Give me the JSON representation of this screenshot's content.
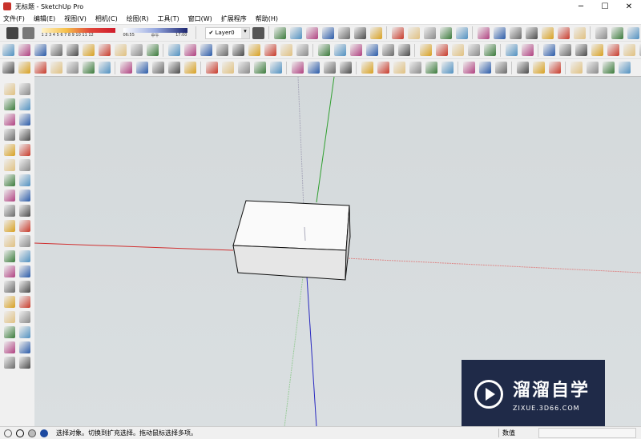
{
  "title": "无标题 - SketchUp Pro",
  "window_controls": {
    "minimize": "─",
    "maximize": "☐",
    "close": "✕"
  },
  "menu": [
    "文件(F)",
    "编辑(E)",
    "视图(V)",
    "相机(C)",
    "绘图(R)",
    "工具(T)",
    "窗口(W)",
    "扩展程序",
    "帮助(H)"
  ],
  "shadow": {
    "months": "1 2 3 4 5 6 7 8 9 10 11 12",
    "time_start": "06:55",
    "time_mid": "中午",
    "time_end": "17:00"
  },
  "layer": {
    "selected": "Layer0",
    "check": "✔"
  },
  "status": {
    "message": "选择对象。切换到扩充选择。拖动鼠标选择多项。",
    "value_label": "数值",
    "value": ""
  },
  "watermark": {
    "brand": "溜溜自学",
    "url": "ZIXUE.3D66.COM"
  },
  "colors": {
    "x_axis": "#d03030",
    "y_axis": "#30a030",
    "z_axis": "#2828c0",
    "viewport": "#d7dcde"
  }
}
